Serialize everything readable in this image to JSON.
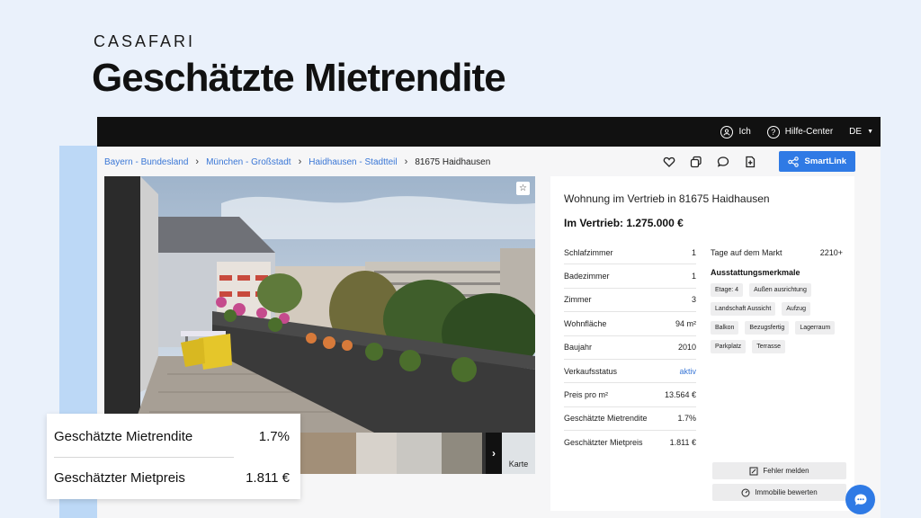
{
  "brand": "CASAFARI",
  "headline": "Geschätzte Mietrendite",
  "topbar": {
    "user_label": "Ich",
    "help_label": "Hilfe-Center",
    "lang": "DE"
  },
  "breadcrumb": [
    "Bayern - Bundesland",
    "München - Großstadt",
    "Haidhausen - Stadtteil",
    "81675 Haidhausen"
  ],
  "toolbar": {
    "smartlink_label": "SmartLink"
  },
  "gallery": {
    "map_label": "Karte"
  },
  "listing": {
    "title": "Wohnung im Vertrieb in 81675 Haidhausen",
    "price": "Im Vertrieb: 1.275.000 €",
    "facts": [
      {
        "label": "Schlafzimmer",
        "value": "1"
      },
      {
        "label": "Badezimmer",
        "value": "1"
      },
      {
        "label": "Zimmer",
        "value": "3"
      },
      {
        "label": "Wohnfläche",
        "value": "94 m²"
      },
      {
        "label": "Baujahr",
        "value": "2010"
      },
      {
        "label": "Verkaufsstatus",
        "value": "aktiv"
      },
      {
        "label": "Preis pro m²",
        "value": "13.564 €"
      },
      {
        "label": "Geschätzte Mietrendite",
        "value": "1.7%"
      },
      {
        "label": "Geschätzter Mietpreis",
        "value": "1.811 €"
      }
    ],
    "days_label": "Tage auf dem Markt",
    "days_value": "2210+",
    "features_heading": "Ausstattungsmerkmale",
    "features": [
      "Etage: 4",
      "Außen ausrichtung",
      "Landschaft Aussicht",
      "Aufzug",
      "Balkon",
      "Bezugsfertig",
      "Lagerraum",
      "Parkplatz",
      "Terrasse"
    ],
    "report_label": "Fehler melden",
    "rate_label": "Immobilie bewerten"
  },
  "overlay": {
    "yield_label": "Geschätzte Mietrendite",
    "yield_value": "1.7%",
    "rent_label": "Geschätzter Mietpreis",
    "rent_value": "1.811 €"
  },
  "colors": {
    "accent": "#2f7ae5",
    "link": "#3a77d6",
    "topbar": "#111111",
    "strip": "#bcd8f6"
  }
}
